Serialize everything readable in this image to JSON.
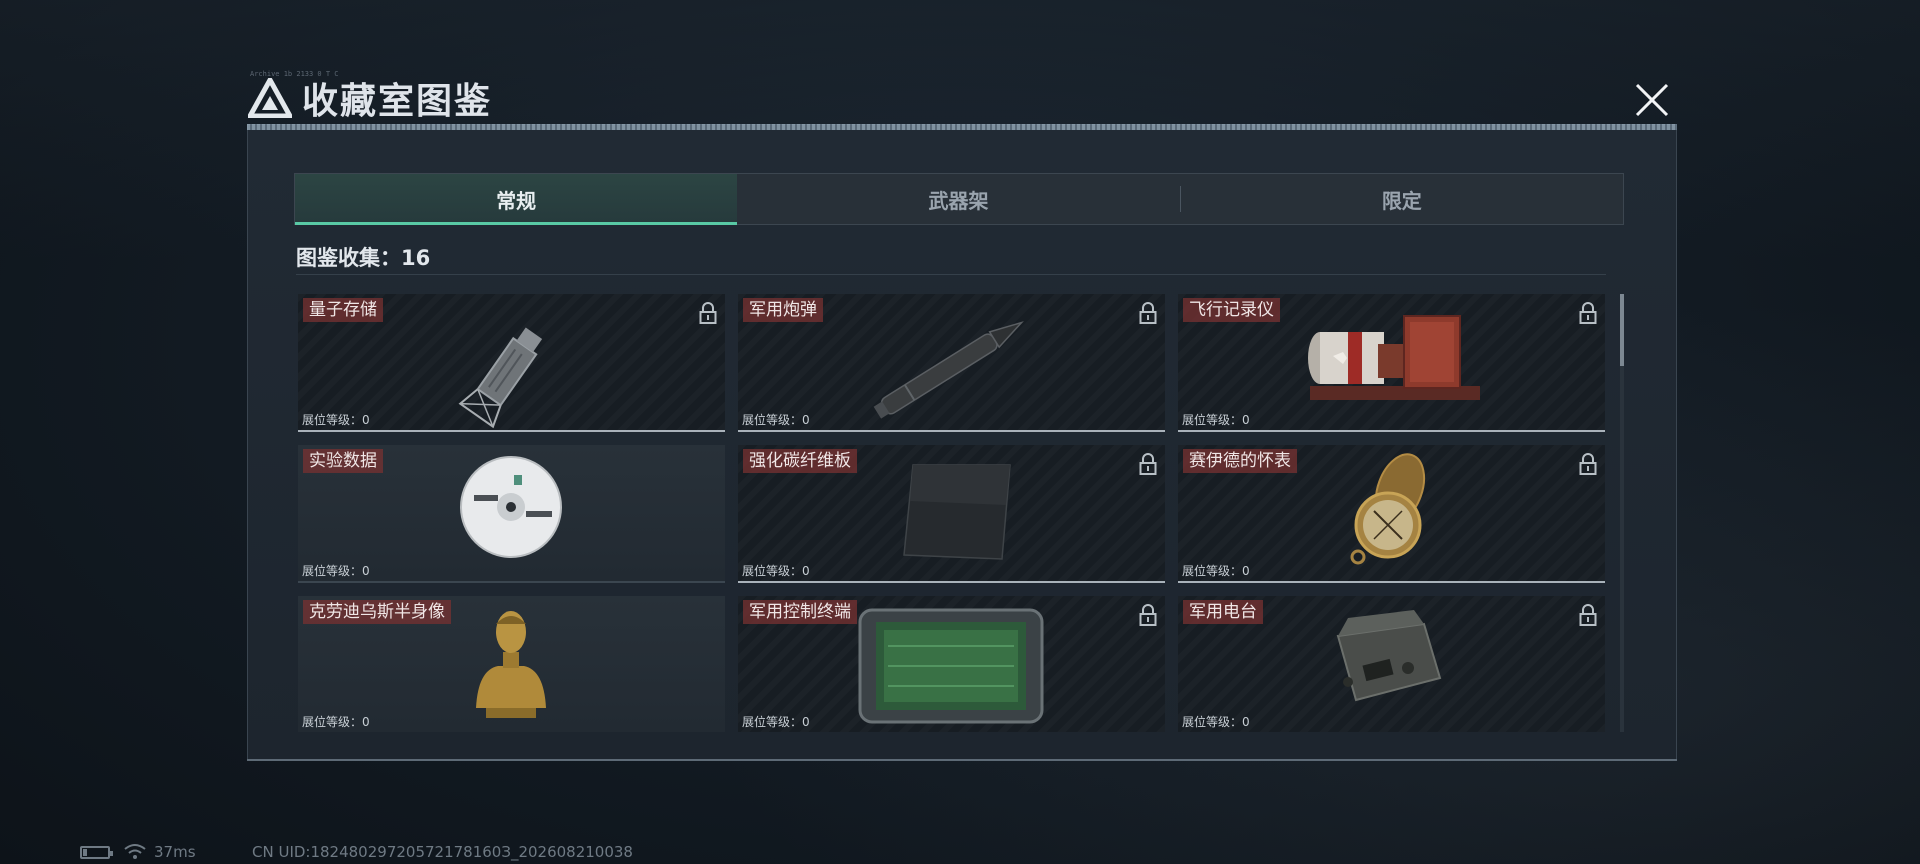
{
  "window": {
    "title": "收藏室图鉴",
    "tiny_caption": "Archive 1b 2133 0 T C"
  },
  "tabs": [
    {
      "label": "常规",
      "active": true
    },
    {
      "label": "武器架",
      "active": false
    },
    {
      "label": "限定",
      "active": false
    }
  ],
  "collection": {
    "label": "图鉴收集：16"
  },
  "items": [
    {
      "name": "量子存储",
      "level": "展位等级：0",
      "locked": true,
      "icon": "usb-drive-icon"
    },
    {
      "name": "军用炮弹",
      "level": "展位等级：0",
      "locked": true,
      "icon": "artillery-shell-icon"
    },
    {
      "name": "飞行记录仪",
      "level": "展位等级：0",
      "locked": true,
      "icon": "flight-recorder-icon"
    },
    {
      "name": "实验数据",
      "level": "展位等级：0",
      "locked": false,
      "icon": "disc-icon"
    },
    {
      "name": "强化碳纤维板",
      "level": "展位等级：0",
      "locked": true,
      "icon": "carbon-plate-icon"
    },
    {
      "name": "赛伊德的怀表",
      "level": "展位等级：0",
      "locked": true,
      "icon": "pocket-watch-icon"
    },
    {
      "name": "克劳迪乌斯半身像",
      "level": "展位等级：0",
      "locked": false,
      "icon": "bust-icon"
    },
    {
      "name": "军用控制终端",
      "level": "展位等级：0",
      "locked": true,
      "icon": "control-terminal-icon"
    },
    {
      "name": "军用电台",
      "level": "展位等级：0",
      "locked": true,
      "icon": "radio-icon"
    }
  ],
  "status_bar": {
    "ping": "37ms",
    "uid": "CN UID:18248029720572178160З_202608210038"
  },
  "colors": {
    "accent": "#59c9a5",
    "name_tag": "#783232",
    "panel": "#212a34"
  }
}
